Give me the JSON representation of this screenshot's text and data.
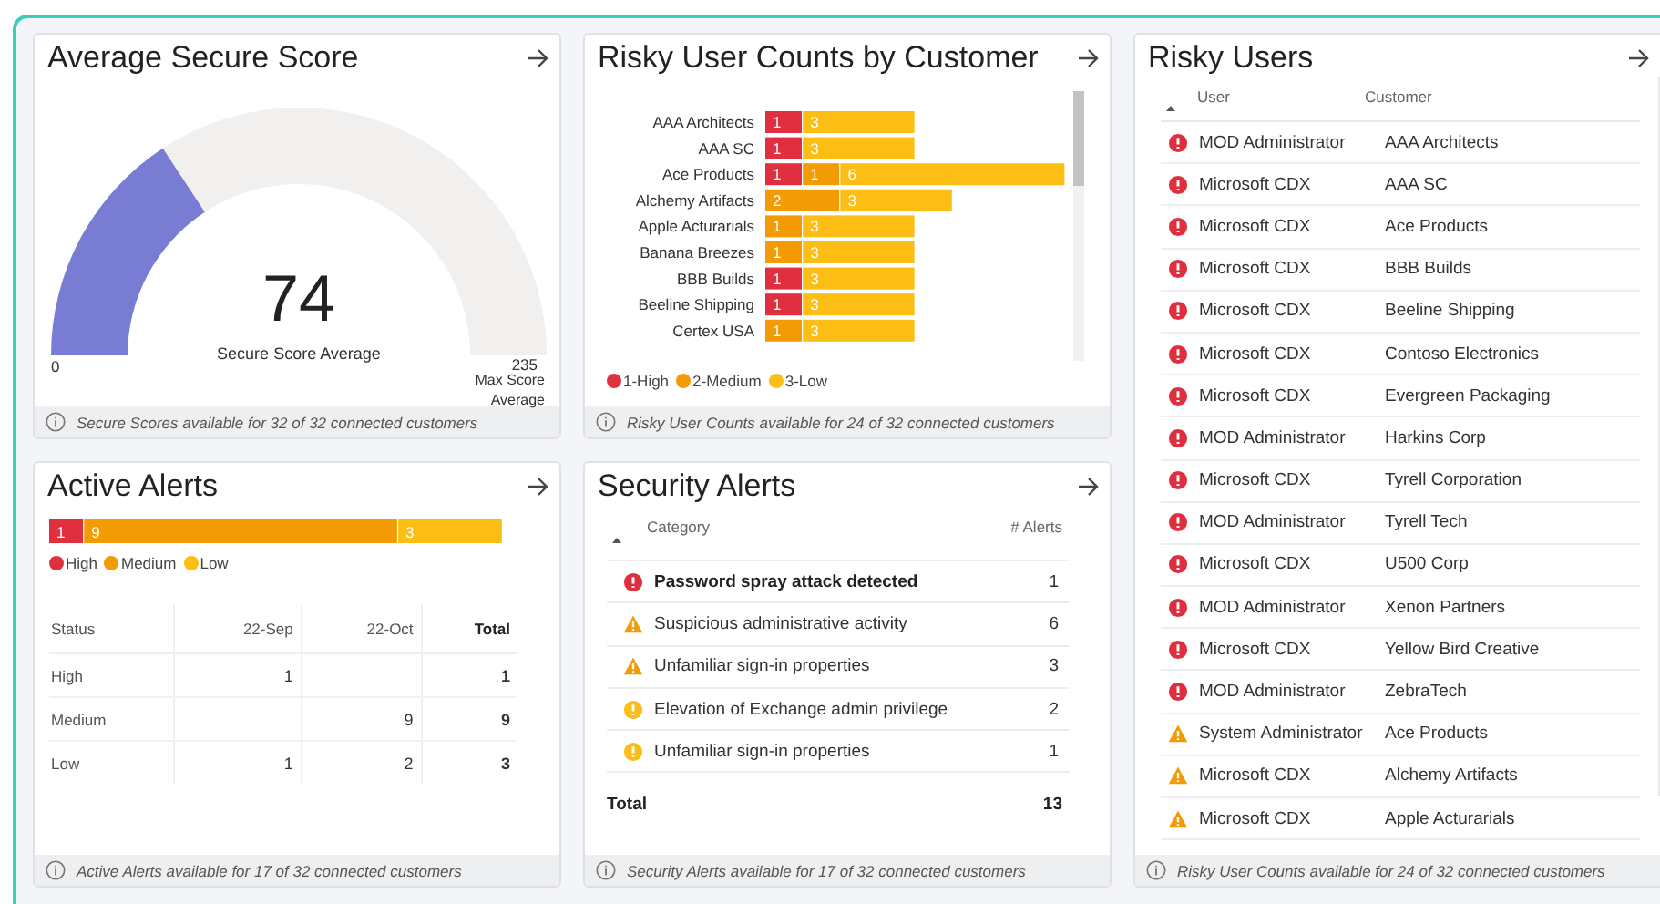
{
  "secure_score": {
    "title": "Average Secure Score",
    "value": "74",
    "caption": "Secure Score Average",
    "min_label": "0",
    "max_value": "235",
    "max_label": "Max Score Average",
    "level": 0.315,
    "footer": "Secure Scores available for 32 of 32 connected customers"
  },
  "risky_counts": {
    "title": "Risky User Counts by Customer",
    "bars": [
      {
        "customer": "AAA Architects",
        "segments": [
          {
            "kind": "high",
            "count": "1"
          },
          {
            "kind": "low",
            "count": "3"
          }
        ]
      },
      {
        "customer": "AAA SC",
        "segments": [
          {
            "kind": "high",
            "count": "1"
          },
          {
            "kind": "low",
            "count": "3"
          }
        ]
      },
      {
        "customer": "Ace Products",
        "segments": [
          {
            "kind": "high",
            "count": "1"
          },
          {
            "kind": "medium",
            "count": "1"
          },
          {
            "kind": "low",
            "count": "6"
          }
        ]
      },
      {
        "customer": "Alchemy Artifacts",
        "segments": [
          {
            "kind": "medium",
            "count": "2"
          },
          {
            "kind": "low",
            "count": "3"
          }
        ]
      },
      {
        "customer": "Apple Acturarials",
        "segments": [
          {
            "kind": "medium",
            "count": "1"
          },
          {
            "kind": "low",
            "count": "3"
          }
        ]
      },
      {
        "customer": "Banana Breezes",
        "segments": [
          {
            "kind": "medium",
            "count": "1"
          },
          {
            "kind": "low",
            "count": "3"
          }
        ]
      },
      {
        "customer": "BBB Builds",
        "segments": [
          {
            "kind": "high",
            "count": "1"
          },
          {
            "kind": "low",
            "count": "3"
          }
        ]
      },
      {
        "customer": "Beeline Shipping",
        "segments": [
          {
            "kind": "high",
            "count": "1"
          },
          {
            "kind": "low",
            "count": "3"
          }
        ]
      },
      {
        "customer": "Certex USA",
        "segments": [
          {
            "kind": "medium",
            "count": "1"
          },
          {
            "kind": "low",
            "count": "3"
          }
        ]
      }
    ],
    "legend": [
      {
        "kind": "high",
        "label": "1-High",
        "color": "#e02f3f"
      },
      {
        "kind": "medium",
        "label": "2-Medium",
        "color": "#f29b05"
      },
      {
        "kind": "low",
        "label": "3-Low",
        "color": "#fcbd14"
      }
    ],
    "footer": "Risky User Counts available for 24 of 32 connected customers"
  },
  "risky_users": {
    "title": "Risky Users",
    "columns": [
      "User",
      "Customer"
    ],
    "rows": [
      {
        "kind": "high",
        "user": "MOD Administrator",
        "customer": "AAA Architects"
      },
      {
        "kind": "high",
        "user": "Microsoft CDX",
        "customer": "AAA SC"
      },
      {
        "kind": "high",
        "user": "Microsoft CDX",
        "customer": "Ace Products"
      },
      {
        "kind": "high",
        "user": "Microsoft CDX",
        "customer": "BBB Builds"
      },
      {
        "kind": "high",
        "user": "Microsoft CDX",
        "customer": "Beeline Shipping"
      },
      {
        "kind": "high",
        "user": "Microsoft CDX",
        "customer": "Contoso Electronics"
      },
      {
        "kind": "high",
        "user": "Microsoft CDX",
        "customer": "Evergreen Packaging"
      },
      {
        "kind": "high",
        "user": "MOD Administrator",
        "customer": "Harkins Corp"
      },
      {
        "kind": "high",
        "user": "Microsoft CDX",
        "customer": "Tyrell Corporation"
      },
      {
        "kind": "high",
        "user": "MOD Administrator",
        "customer": "Tyrell Tech"
      },
      {
        "kind": "high",
        "user": "Microsoft CDX",
        "customer": "U500 Corp"
      },
      {
        "kind": "high",
        "user": "MOD Administrator",
        "customer": "Xenon Partners"
      },
      {
        "kind": "high",
        "user": "Microsoft CDX",
        "customer": "Yellow Bird Creative"
      },
      {
        "kind": "high",
        "user": "MOD Administrator",
        "customer": "ZebraTech"
      },
      {
        "kind": "medium",
        "user": "System Administrator",
        "customer": "Ace Products"
      },
      {
        "kind": "medium",
        "user": "Microsoft CDX",
        "customer": "Alchemy Artifacts"
      },
      {
        "kind": "medium",
        "user": "Microsoft CDX",
        "customer": "Apple Acturarials"
      }
    ],
    "footer": "Risky User Counts available for 24 of 32 connected customers"
  },
  "active_alerts": {
    "title": "Active Alerts",
    "segments": [
      {
        "kind": "high",
        "count": "1"
      },
      {
        "kind": "medium",
        "count": "9"
      },
      {
        "kind": "low",
        "count": "3"
      }
    ],
    "legend": [
      {
        "kind": "high",
        "label": "High",
        "color": "#e02f3f"
      },
      {
        "kind": "medium",
        "label": "Medium",
        "color": "#f29b05"
      },
      {
        "kind": "low",
        "label": "Low",
        "color": "#fcbd14"
      }
    ],
    "table": {
      "columns": [
        "Status",
        "22-Sep",
        "22-Oct",
        "Total"
      ],
      "rows": [
        [
          "High",
          "1",
          "",
          "1"
        ],
        [
          "Medium",
          "",
          "9",
          "9"
        ],
        [
          "Low",
          "1",
          "2",
          "3"
        ]
      ]
    },
    "footer": "Active Alerts available for 17 of 32 connected customers"
  },
  "security_alerts": {
    "title": "Security Alerts",
    "columns": [
      "Category",
      "# Alerts"
    ],
    "rows": [
      {
        "kind": "high",
        "bold": true,
        "category": "Password spray attack detected",
        "count": "1"
      },
      {
        "kind": "medium",
        "bold": false,
        "category": "Suspicious administrative activity",
        "count": "6"
      },
      {
        "kind": "medium",
        "bold": false,
        "category": "Unfamiliar sign-in properties",
        "count": "3"
      },
      {
        "kind": "low",
        "bold": false,
        "category": "Elevation of Exchange admin privilege",
        "count": "2"
      },
      {
        "kind": "low",
        "bold": false,
        "category": "Unfamiliar sign-in properties",
        "count": "1"
      }
    ],
    "total_label": "Total",
    "total": "13",
    "footer": "Security Alerts available for 17 of 32 connected customers"
  }
}
